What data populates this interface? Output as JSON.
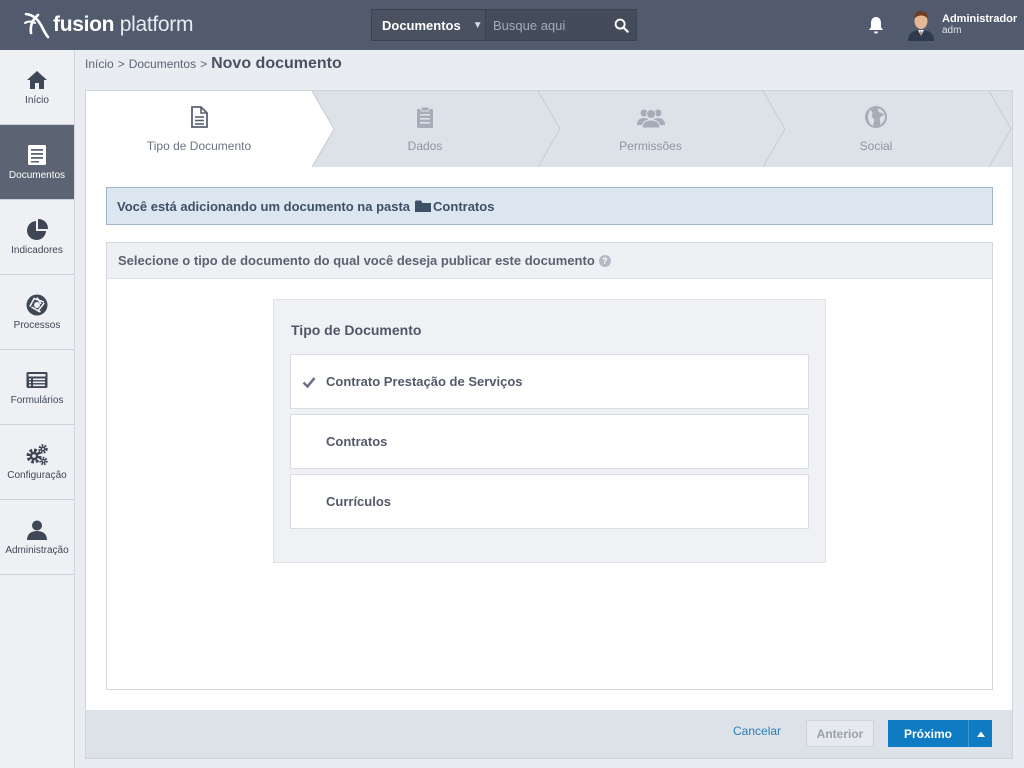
{
  "app": {
    "brand_bold": "fusion",
    "brand_light": " platform"
  },
  "search": {
    "scope": "Documentos",
    "placeholder": "Busque aqui"
  },
  "user": {
    "name": "Administrador",
    "login": "adm"
  },
  "sidebar": {
    "items": [
      {
        "label": "Início",
        "icon": "home-icon",
        "active": false
      },
      {
        "label": "Documentos",
        "icon": "document-icon",
        "active": true
      },
      {
        "label": "Indicadores",
        "icon": "pie-chart-icon",
        "active": false
      },
      {
        "label": "Processos",
        "icon": "aperture-icon",
        "active": false
      },
      {
        "label": "Formulários",
        "icon": "form-icon",
        "active": false
      },
      {
        "label": "Configuração",
        "icon": "gears-icon",
        "active": false
      },
      {
        "label": "Administração",
        "icon": "user-icon",
        "active": false
      }
    ]
  },
  "breadcrumb": {
    "home": "Início",
    "section": "Documentos",
    "sep": ">",
    "current": "Novo documento"
  },
  "wizard": {
    "steps": [
      {
        "label": "Tipo de Documento",
        "icon": "file-icon",
        "active": true
      },
      {
        "label": "Dados",
        "icon": "clipboard-icon",
        "active": false
      },
      {
        "label": "Permissões",
        "icon": "users-icon",
        "active": false
      },
      {
        "label": "Social",
        "icon": "globe-icon",
        "active": false
      }
    ]
  },
  "info": {
    "text": "Você está adicionando um documento na pasta",
    "folder": "Contratos"
  },
  "select": {
    "heading": "Selecione o tipo de documento do qual você deseja publicar este documento",
    "help": "?",
    "title": "Tipo de Documento",
    "options": [
      {
        "label": "Contrato Prestação de Serviços",
        "selected": true
      },
      {
        "label": "Contratos",
        "selected": false
      },
      {
        "label": "Currículos",
        "selected": false
      }
    ]
  },
  "footer": {
    "cancel": "Cancelar",
    "previous": "Anterior",
    "next": "Próximo"
  },
  "colors": {
    "topbar": "#525b6e",
    "sidebar_active": "#5c6474",
    "primary": "#0f7bc3",
    "info_bg": "#dce6f1",
    "link": "#2a7fb8"
  }
}
